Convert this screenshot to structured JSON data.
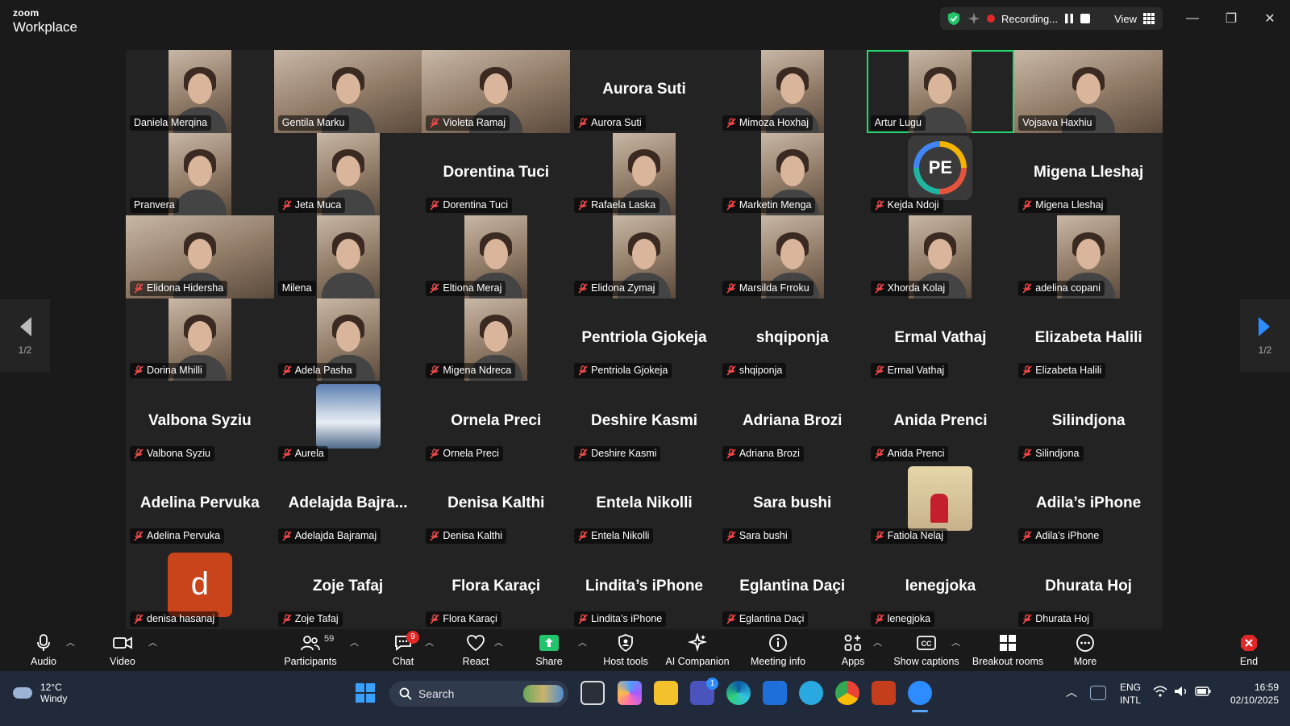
{
  "window": {
    "brand_small": "zoom",
    "brand_name": "Workplace",
    "recording_label": "Recording...",
    "view_label": "View",
    "minimize_glyph": "—",
    "maximize_glyph": "❐",
    "close_glyph": "✕"
  },
  "gallery": {
    "page_indicator_left": "1/2",
    "page_indicator_right": "1/2",
    "tiles": [
      {
        "name": "Daniela Merqina",
        "muted": false,
        "kind": "photo",
        "big": ""
      },
      {
        "name": "Gentila Marku",
        "muted": false,
        "kind": "photo-wide",
        "big": ""
      },
      {
        "name": "Violeta  Ramaj",
        "muted": true,
        "kind": "photo-wide",
        "big": ""
      },
      {
        "name": "Aurora Suti",
        "muted": true,
        "kind": "name",
        "big": "Aurora Suti"
      },
      {
        "name": "Mimoza Hoxhaj",
        "muted": true,
        "kind": "photo",
        "big": ""
      },
      {
        "name": "Artur Lugu",
        "muted": false,
        "kind": "photo",
        "big": "",
        "active": true
      },
      {
        "name": "Vojsava Haxhiu",
        "muted": false,
        "kind": "photo-wide",
        "big": ""
      },
      {
        "name": "Pranvera",
        "muted": false,
        "kind": "photo",
        "big": ""
      },
      {
        "name": "Jeta Muca",
        "muted": true,
        "kind": "photo",
        "big": ""
      },
      {
        "name": "Dorentina Tuci",
        "muted": true,
        "kind": "name",
        "big": "Dorentina Tuci"
      },
      {
        "name": "Rafaela Laska",
        "muted": true,
        "kind": "photo",
        "big": ""
      },
      {
        "name": "Marketin Menga",
        "muted": true,
        "kind": "photo",
        "big": ""
      },
      {
        "name": "Kejda Ndoji",
        "muted": true,
        "kind": "pe",
        "big": "PE"
      },
      {
        "name": "Migena Lleshaj",
        "muted": true,
        "kind": "name",
        "big": "Migena Lleshaj"
      },
      {
        "name": "Elidona Hidersha",
        "muted": true,
        "kind": "photo-wide",
        "big": ""
      },
      {
        "name": "Milena",
        "muted": false,
        "kind": "photo",
        "big": ""
      },
      {
        "name": "Eltiona Meraj",
        "muted": true,
        "kind": "photo",
        "big": ""
      },
      {
        "name": "Elidona Zymaj",
        "muted": true,
        "kind": "photo",
        "big": ""
      },
      {
        "name": "Marsilda Frroku",
        "muted": true,
        "kind": "photo",
        "big": ""
      },
      {
        "name": "Xhorda Kolaj",
        "muted": true,
        "kind": "photo",
        "big": ""
      },
      {
        "name": "adelina copani",
        "muted": true,
        "kind": "photo",
        "big": ""
      },
      {
        "name": "Dorina Mhilli",
        "muted": true,
        "kind": "photo",
        "big": ""
      },
      {
        "name": "Adela Pasha",
        "muted": true,
        "kind": "photo",
        "big": ""
      },
      {
        "name": "Migena Ndreca",
        "muted": true,
        "kind": "photo",
        "big": ""
      },
      {
        "name": "Pentriola Gjokeja",
        "muted": true,
        "kind": "name",
        "big": "Pentriola Gjokeja"
      },
      {
        "name": "shqiponja",
        "muted": true,
        "kind": "name",
        "big": "shqiponja"
      },
      {
        "name": "Ermal Vathaj",
        "muted": true,
        "kind": "name",
        "big": "Ermal Vathaj"
      },
      {
        "name": "Elizabeta Halili",
        "muted": true,
        "kind": "name",
        "big": "Elizabeta Halili"
      },
      {
        "name": "Valbona Syziu",
        "muted": true,
        "kind": "name",
        "big": "Valbona Syziu"
      },
      {
        "name": "Aurela",
        "muted": true,
        "kind": "sky",
        "big": ""
      },
      {
        "name": "Ornela Preci",
        "muted": true,
        "kind": "name",
        "big": "Ornela Preci"
      },
      {
        "name": "Deshire Kasmi",
        "muted": true,
        "kind": "name",
        "big": "Deshire Kasmi"
      },
      {
        "name": "Adriana Brozi",
        "muted": true,
        "kind": "name",
        "big": "Adriana Brozi"
      },
      {
        "name": "Anida Prenci",
        "muted": true,
        "kind": "name",
        "big": "Anida Prenci"
      },
      {
        "name": "Silindjona",
        "muted": true,
        "kind": "name",
        "big": "Silindjona"
      },
      {
        "name": "Adelina Pervuka",
        "muted": true,
        "kind": "name",
        "big": "Adelina Pervuka"
      },
      {
        "name": "Adelajda Bajramaj",
        "muted": true,
        "kind": "name",
        "big": "Adelajda  Bajra..."
      },
      {
        "name": "Denisa Kalthi",
        "muted": true,
        "kind": "name",
        "big": "Denisa Kalthi"
      },
      {
        "name": "Entela Nikolli",
        "muted": true,
        "kind": "name",
        "big": "Entela Nikolli"
      },
      {
        "name": "Sara bushi",
        "muted": true,
        "kind": "name",
        "big": "Sara bushi"
      },
      {
        "name": "Fatiola Nelaj",
        "muted": true,
        "kind": "kid",
        "big": ""
      },
      {
        "name": "Adila’s iPhone",
        "muted": true,
        "kind": "name",
        "big": "Adila’s iPhone"
      },
      {
        "name": "denisa hasanaj",
        "muted": true,
        "kind": "letter",
        "big": "d"
      },
      {
        "name": "Zoje Tafaj",
        "muted": true,
        "kind": "name",
        "big": "Zoje Tafaj"
      },
      {
        "name": "Flora Karaçi",
        "muted": true,
        "kind": "name",
        "big": "Flora Karaçi"
      },
      {
        "name": "Lindita’s iPhone",
        "muted": true,
        "kind": "name",
        "big": "Lindita’s iPhone"
      },
      {
        "name": "Eglantina Daçi",
        "muted": true,
        "kind": "name",
        "big": "Eglantina Daçi"
      },
      {
        "name": "lenegjoka",
        "muted": true,
        "kind": "name",
        "big": "lenegjoka"
      },
      {
        "name": "Dhurata Hoj",
        "muted": true,
        "kind": "name",
        "big": "Dhurata Hoj"
      }
    ]
  },
  "toolbar": {
    "audio": "Audio",
    "video": "Video",
    "participants": "Participants",
    "participants_count": "59",
    "chat": "Chat",
    "chat_badge": "9",
    "react": "React",
    "share": "Share",
    "host_tools": "Host tools",
    "ai_companion": "AI Companion",
    "meeting_info": "Meeting info",
    "apps": "Apps",
    "show_captions": "Show captions",
    "breakout_rooms": "Breakout rooms",
    "more": "More",
    "end": "End",
    "share_color": "#23c36b",
    "end_color": "#e02828"
  },
  "taskbar": {
    "temperature": "12°C",
    "weather": "Windy",
    "search_placeholder": "Search",
    "lang_top": "ENG",
    "lang_bottom": "INTL",
    "time": "16:59",
    "date": "02/10/2025",
    "teams_badge": "1"
  }
}
